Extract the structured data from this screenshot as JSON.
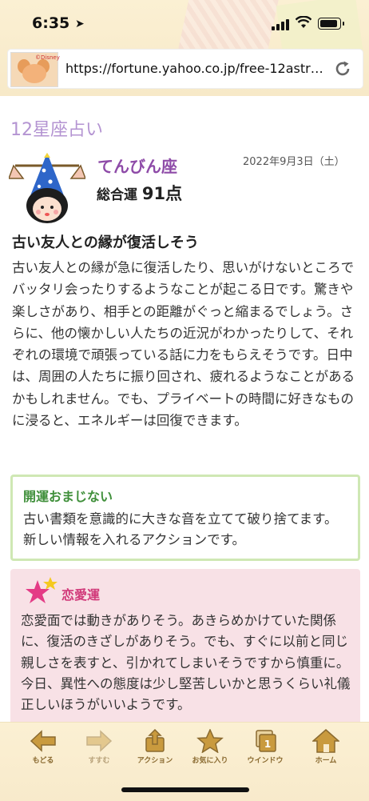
{
  "status_bar": {
    "time": "6:35",
    "location_glyph": "➤"
  },
  "browser": {
    "url": "https://fortune.yahoo.co.jp/free-12astr…",
    "avatar_badge": "©Disney"
  },
  "page": {
    "title": "12星座占い"
  },
  "sign": {
    "name": "てんびん座",
    "date": "2022年9月3日（土）",
    "overall_label": "総合運",
    "overall_score": "91点"
  },
  "fortune": {
    "headline": "古い友人との縁が復活しそう",
    "body": "古い友人との縁が急に復活したり、思いがけないところでバッタリ会ったりするようなことが起こる日です。驚きや楽しさがあり、相手との距離がぐっと縮まるでしょう。さらに、他の懐かしい人たちの近況がわかったりして、それぞれの環境で頑張っている話に力をもらえそうです。日中は、周囲の人たちに振り回され、疲れるようなことがあるかもしれません。でも、プライベートの時間に好きなものに浸ると、エネルギーは回復できます。"
  },
  "charm": {
    "title": "開運おまじない",
    "text": "古い書類を意識的に大きな音を立てて破り捨てます。新しい情報を入れるアクションです。"
  },
  "love": {
    "title": "恋愛運",
    "text": "恋愛面では動きがありそう。あきらめかけていた関係に、復活のきざしがありそう。でも、すぐに以前と同じ親しさを表すと、引かれてしまいそうですから慎重に。今日、異性への態度は少し堅苦しいかと思うくらい礼儀正しいほうがいいようです。"
  },
  "toolbar": {
    "back": "もどる",
    "forward": "すすむ",
    "action": "アクション",
    "favorites": "お気に入り",
    "window": "ウインドウ",
    "window_count": "1",
    "home": "ホーム"
  },
  "colors": {
    "title_purple": "#b494d2",
    "sign_purple": "#8e4ba8",
    "charm_green": "#3f8f3a",
    "love_pink": "#d13a7a",
    "toolbar_brown": "#8a6a30"
  }
}
